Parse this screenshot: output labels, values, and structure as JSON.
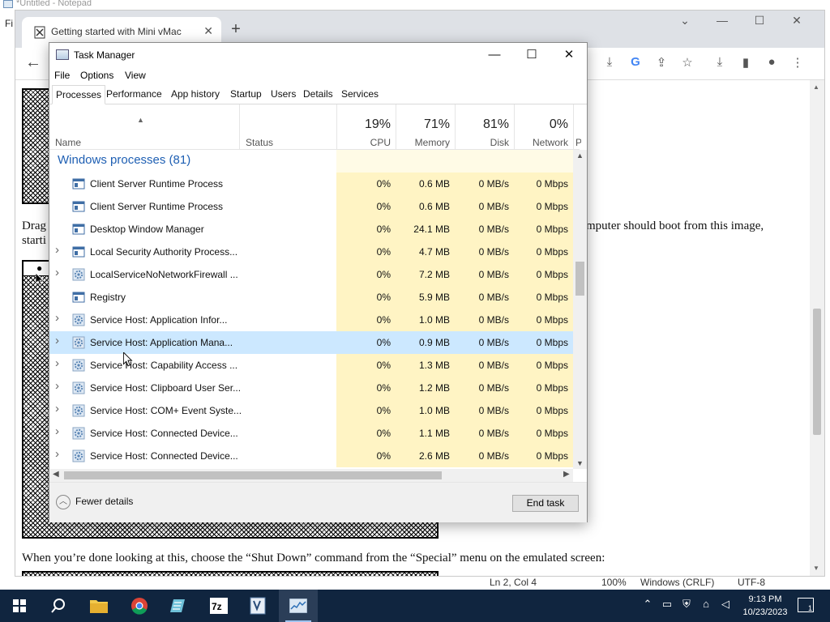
{
  "notepad": {
    "title": "*Untitled - Notepad",
    "menu_first": "Fi",
    "status": {
      "position": "Ln 2, Col 4",
      "zoom": "100%",
      "line_endings": "Windows (CRLF)",
      "encoding": "UTF-8"
    }
  },
  "browser": {
    "tab_title": "Getting started with Mini vMac",
    "new_tab": "+",
    "close_tab": "✕",
    "page": {
      "line1_left": "Drag",
      "line1_right": "mputer should boot from this image,",
      "line2_left": "starti",
      "line3": "When you’re done looking at this, choose the “Shut Down” command from the “Special” menu on the emulated screen:"
    }
  },
  "task_manager": {
    "title": "Task Manager",
    "menu": [
      "File",
      "Options",
      "View"
    ],
    "tabs": [
      "Processes",
      "Performance",
      "App history",
      "Startup",
      "Users",
      "Details",
      "Services"
    ],
    "active_tab": "Processes",
    "columns": {
      "name": "Name",
      "status": "Status",
      "cpu": {
        "pct": "19%",
        "label": "CPU"
      },
      "memory": {
        "pct": "71%",
        "label": "Memory"
      },
      "disk": {
        "pct": "81%",
        "label": "Disk"
      },
      "network": {
        "pct": "0%",
        "label": "Network"
      },
      "power": "P"
    },
    "group_title": "Windows processes (81)",
    "rows": [
      {
        "name": "Client Server Runtime Process",
        "cpu": "0%",
        "memory": "0.6 MB",
        "disk": "0 MB/s",
        "network": "0 Mbps",
        "expandable": false,
        "icon": "window-icon"
      },
      {
        "name": "Client Server Runtime Process",
        "cpu": "0%",
        "memory": "0.6 MB",
        "disk": "0 MB/s",
        "network": "0 Mbps",
        "expandable": false,
        "icon": "window-icon"
      },
      {
        "name": "Desktop Window Manager",
        "cpu": "0%",
        "memory": "24.1 MB",
        "disk": "0 MB/s",
        "network": "0 Mbps",
        "expandable": false,
        "icon": "window-icon"
      },
      {
        "name": "Local Security Authority Process...",
        "cpu": "0%",
        "memory": "4.7 MB",
        "disk": "0 MB/s",
        "network": "0 Mbps",
        "expandable": true,
        "icon": "window-icon"
      },
      {
        "name": "LocalServiceNoNetworkFirewall ...",
        "cpu": "0%",
        "memory": "7.2 MB",
        "disk": "0 MB/s",
        "network": "0 Mbps",
        "expandable": true,
        "icon": "gear-icon"
      },
      {
        "name": "Registry",
        "cpu": "0%",
        "memory": "5.9 MB",
        "disk": "0 MB/s",
        "network": "0 Mbps",
        "expandable": false,
        "icon": "window-icon"
      },
      {
        "name": "Service Host: Application Infor...",
        "cpu": "0%",
        "memory": "1.0 MB",
        "disk": "0 MB/s",
        "network": "0 Mbps",
        "expandable": true,
        "icon": "gear-icon"
      },
      {
        "name": "Service Host: Application Mana...",
        "cpu": "0%",
        "memory": "0.9 MB",
        "disk": "0 MB/s",
        "network": "0 Mbps",
        "expandable": true,
        "icon": "gear-icon",
        "selected": true
      },
      {
        "name": "Service Host: Capability Access ...",
        "cpu": "0%",
        "memory": "1.3 MB",
        "disk": "0 MB/s",
        "network": "0 Mbps",
        "expandable": true,
        "icon": "gear-icon"
      },
      {
        "name": "Service Host: Clipboard User Ser...",
        "cpu": "0%",
        "memory": "1.2 MB",
        "disk": "0 MB/s",
        "network": "0 Mbps",
        "expandable": true,
        "icon": "gear-icon"
      },
      {
        "name": "Service Host: COM+ Event Syste...",
        "cpu": "0%",
        "memory": "1.0 MB",
        "disk": "0 MB/s",
        "network": "0 Mbps",
        "expandable": true,
        "icon": "gear-icon"
      },
      {
        "name": "Service Host: Connected Device...",
        "cpu": "0%",
        "memory": "1.1 MB",
        "disk": "0 MB/s",
        "network": "0 Mbps",
        "expandable": true,
        "icon": "gear-icon"
      },
      {
        "name": "Service Host: Connected Device...",
        "cpu": "0%",
        "memory": "2.6 MB",
        "disk": "0 MB/s",
        "network": "0 Mbps",
        "expandable": true,
        "icon": "gear-icon"
      }
    ],
    "fewer_details": "Fewer details",
    "end_task": "End task"
  },
  "taskbar": {
    "time": "9:13 PM",
    "date": "10/23/2023",
    "notification_count": "1",
    "apps": [
      "start-icon",
      "search-icon",
      "file-explorer-icon",
      "chrome-icon",
      "notepad-icon",
      "7zip-icon",
      "text-editor-icon",
      "task-manager-icon"
    ]
  },
  "colors": {
    "heat_cell": "#fff4c4",
    "selected_row": "#cce8ff",
    "group_title": "#1e5fb3",
    "taskbar": "#10253f"
  }
}
